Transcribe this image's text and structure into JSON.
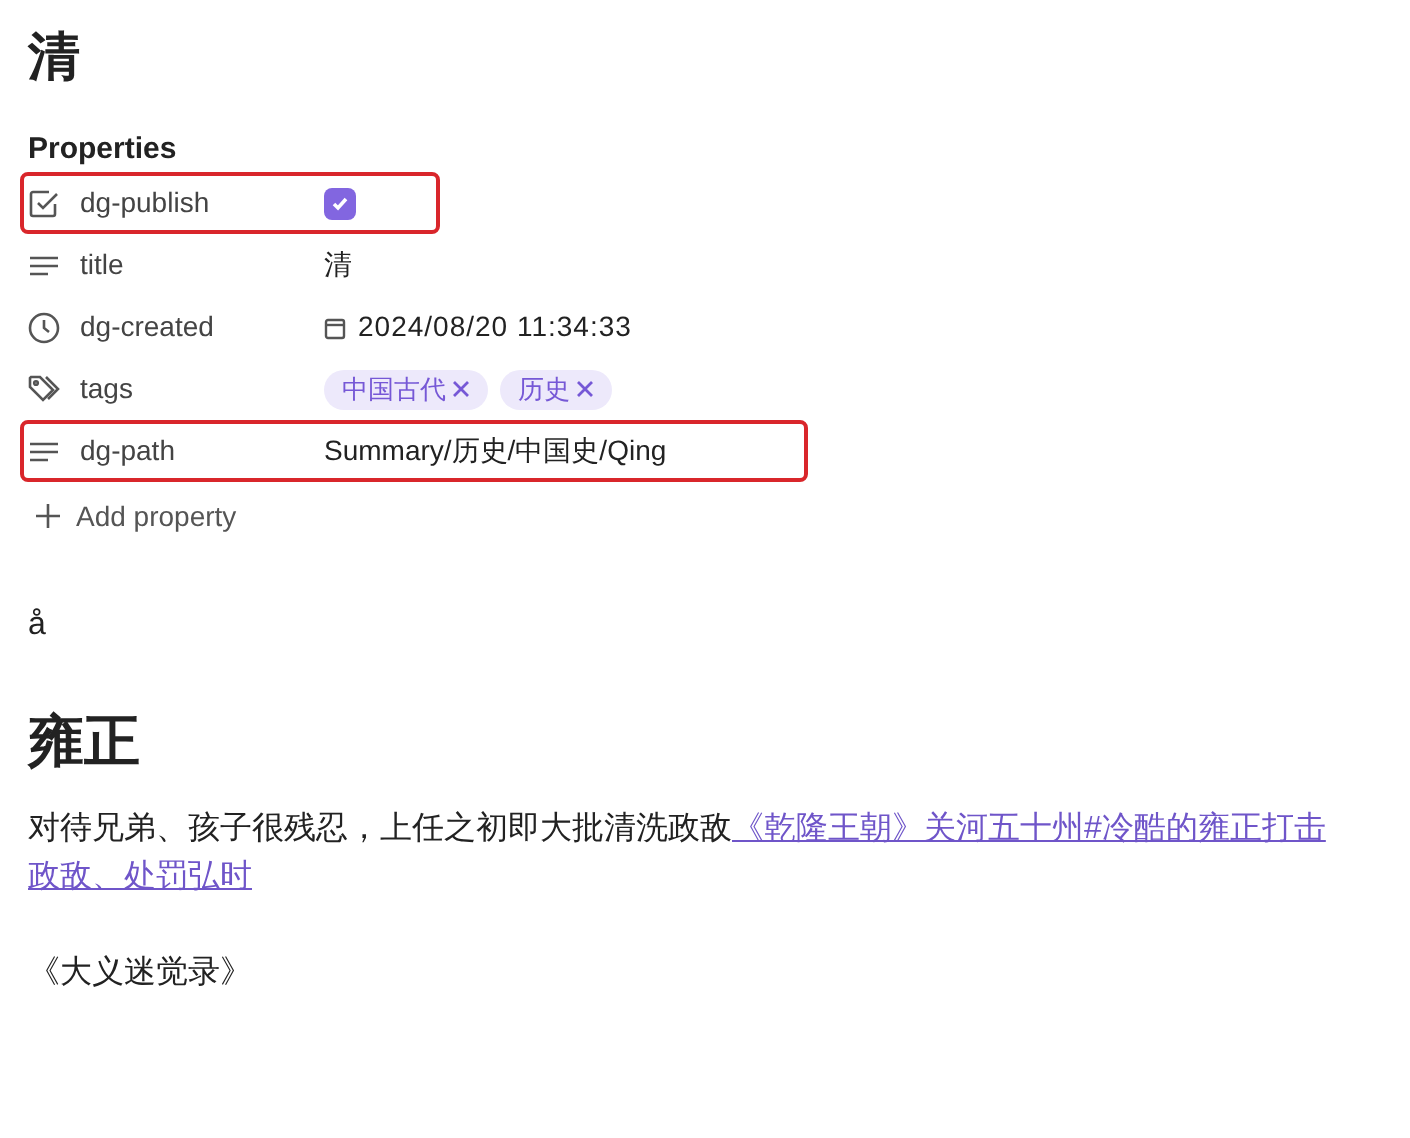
{
  "heading": "清",
  "properties": {
    "title": "Properties",
    "items": [
      {
        "kind": "checkbox",
        "name": "dg-publish",
        "checked": true,
        "highlighted": true
      },
      {
        "kind": "text",
        "name": "title",
        "value": "清",
        "highlighted": false
      },
      {
        "kind": "datetime",
        "name": "dg-created",
        "value": "2024/08/20 11:34:33",
        "highlighted": false
      },
      {
        "kind": "tags",
        "name": "tags",
        "tags": [
          "中国古代",
          "历史"
        ],
        "highlighted": false
      },
      {
        "kind": "text",
        "name": "dg-path",
        "value": "Summary/历史/中国史/Qing",
        "highlighted": true
      }
    ],
    "add_label": "Add property"
  },
  "body": [
    {
      "kind": "text",
      "text": "å"
    },
    {
      "kind": "heading",
      "text": "雍正"
    },
    {
      "kind": "paragraph",
      "text": "对待兄弟、孩子很残忍，上任之初即大批清洗政敌",
      "link_lines": [
        "《乾隆王朝》关河五十州#冷酷的雍正打击",
        "政敌、处罚弘时"
      ]
    },
    {
      "kind": "text",
      "text": "《大义迷觉录》"
    }
  ]
}
